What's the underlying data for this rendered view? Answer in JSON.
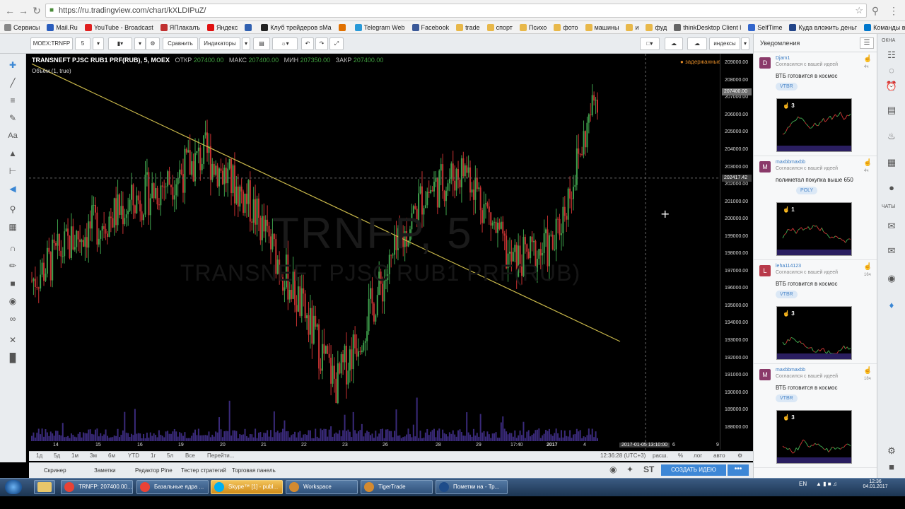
{
  "browser": {
    "url": "https://ru.tradingview.com/chart/kXLDIPuZ/",
    "bookmarks": [
      "Сервисы",
      "Mail.Ru",
      "YouTube - Broadcast",
      "ЯПлакалъ",
      "Яндекс",
      "",
      "Клуб трейдеров sMa",
      "",
      "Telegram Web",
      "Facebook",
      "trade",
      "спорт",
      "Психо",
      "фото",
      "машины",
      "и",
      "фуд",
      "thinkDesktop Client l",
      "SelfTime",
      "Куда вложить деньг",
      "Команды в чате Ска"
    ]
  },
  "toolbar": {
    "symbol": "MOEX:TRNFP",
    "interval": "5",
    "compare": "Сравнить",
    "indicators": "Индикаторы",
    "indices": "индексы"
  },
  "legend": {
    "title": "TRANSNEFT PJSC RUB1 PRF(RUB), 5, MOEX",
    "open_label": "ОТКР",
    "open": "207400.00",
    "high_label": "МАКС",
    "high": "207400.00",
    "low_label": "МИН",
    "low": "207350.00",
    "close_label": "ЗАКР",
    "close": "207400.00",
    "volume": "Объём (1, true)",
    "delayed": "задержанные"
  },
  "watermark": {
    "symbol": "TRNFP, 5",
    "name": "TRANSNEFT PJSC RUB1 PRF(RUB)"
  },
  "price_axis": {
    "labels": [
      "209000.00",
      "208000.00",
      "207000.00",
      "206000.00",
      "205000.00",
      "204000.00",
      "203000.00",
      "202000.00",
      "201000.00",
      "200000.00",
      "199000.00",
      "198000.00",
      "197000.00",
      "196000.00",
      "195000.00",
      "194000.00",
      "193000.00",
      "192000.00",
      "191000.00",
      "190000.00",
      "189000.00",
      "188000.00"
    ],
    "last_price": "207400.00",
    "cursor_price": "202417.42"
  },
  "time_axis": {
    "labels": [
      "14",
      "15",
      "16",
      "19",
      "20",
      "21",
      "22",
      "23",
      "26",
      "28",
      "29",
      "17:40",
      "2017",
      "4",
      "6",
      "9"
    ],
    "cursor_time": "2017-01-05 13:10:00"
  },
  "range_bar": {
    "ranges": [
      "1д",
      "5д",
      "1м",
      "3м",
      "6м",
      "YTD",
      "1г",
      "5л",
      "Все",
      "Перейти..."
    ],
    "time": "12:36:28 (UTC+3)",
    "scale": [
      "расш.",
      "%",
      "лог",
      "авто"
    ]
  },
  "bottom_tabs": [
    "Скринер",
    "Заметки",
    "Редактор Pine",
    "Тестер стратегий",
    "Торговая панель"
  ],
  "create_idea": "СОЗДАТЬ ИДЕЮ",
  "more": "•••",
  "notifications": {
    "title": "Уведомления",
    "items": [
      {
        "initial": "D",
        "color": "#8a3a6a",
        "user": "Djam1",
        "sub": "Согласился с вашей идеей",
        "text": "ВТБ готовится в космос",
        "tag": "VTBR",
        "likes": "3",
        "time": "4ч"
      },
      {
        "initial": "M",
        "color": "#8a3a6a",
        "user": "maxbbmaxbb",
        "sub": "Согласился с вашей идеей",
        "text": "полиметал покупка выше 650",
        "tag": "POLY",
        "likes": "1",
        "time": "4ч"
      },
      {
        "initial": "L",
        "color": "#b83a4a",
        "user": "leha114123",
        "sub": "Согласился с вашей идеей",
        "text": "ВТБ готовится в космос",
        "tag": "VTBR",
        "likes": "3",
        "time": "16ч"
      },
      {
        "initial": "M",
        "color": "#8a3a6a",
        "user": "maxbbmaxbb",
        "sub": "Согласился с вашей идеей",
        "text": "ВТБ готовится в космос",
        "tag": "VTBR",
        "likes": "3",
        "time": "18ч"
      }
    ]
  },
  "right_sidebar": {
    "label_top": "ОКНА",
    "label_chats": "ЧАТЫ"
  },
  "taskbar": {
    "tasks": [
      "TRNFP: 207400.00...",
      "Базальные ядра ...",
      "Skype™ [1] - publ...",
      "Workspace",
      "TigerTrade",
      "Пометки на - Тр..."
    ],
    "lang": "EN",
    "time": "12:36",
    "date": "04.01.2017"
  },
  "chart_data": {
    "type": "candlestick",
    "title": "TRANSNEFT PJSC RUB1 PRF(RUB), 5, MOEX",
    "ylim": [
      187500,
      209500
    ],
    "x": [
      "14",
      "15",
      "16",
      "19",
      "20",
      "21",
      "22",
      "23",
      "26",
      "28",
      "29",
      "17:40",
      "2017",
      "4"
    ],
    "close": [
      196500,
      199000,
      200500,
      202000,
      203800,
      201000,
      196000,
      190500,
      196000,
      201500,
      203000,
      197500,
      198500,
      207400
    ],
    "trendline": {
      "from": [
        0,
        209000
      ],
      "to": [
        13.3,
        193000
      ]
    },
    "grid": false
  }
}
